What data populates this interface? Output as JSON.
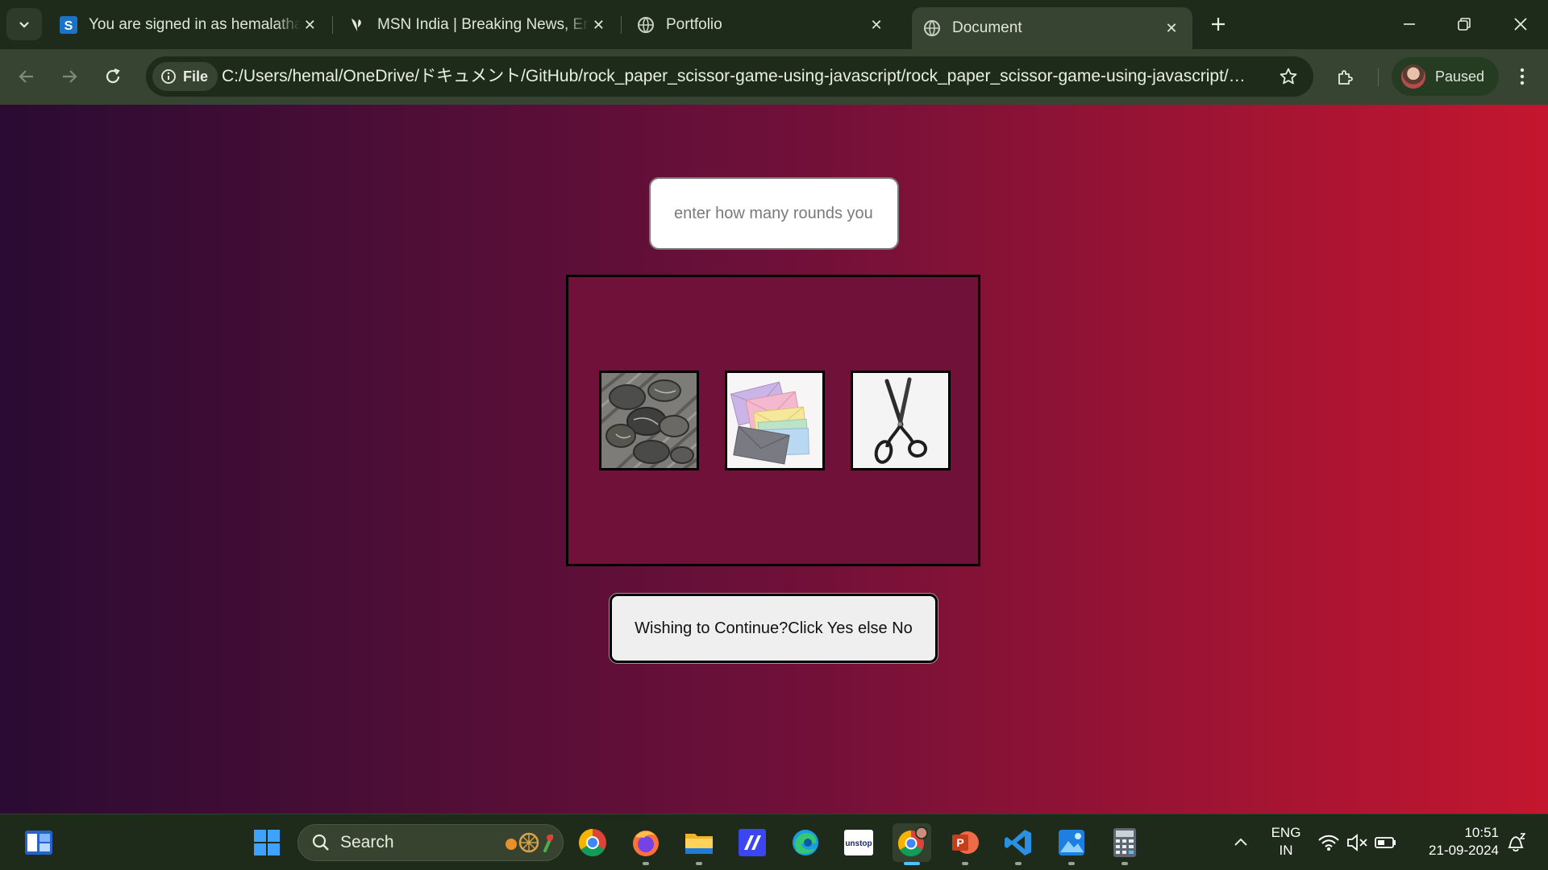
{
  "browser": {
    "tabs": [
      {
        "title": "You are signed in as hemalathaj",
        "favicon": "s-logo-icon",
        "active": false
      },
      {
        "title": "MSN India | Breaking News, Ent",
        "favicon": "msn-butterfly-icon",
        "active": false
      },
      {
        "title": "Portfolio",
        "favicon": "globe-icon",
        "active": false
      },
      {
        "title": "Document",
        "favicon": "globe-icon",
        "active": true
      }
    ],
    "address": {
      "chip_label": "File",
      "url": "C:/Users/hemal/OneDrive/ドキュメント/GitHub/rock_paper_scissor-game-using-javascript/rock_paper_scissor-game-using-javascript/practic..."
    },
    "profile": {
      "status": "Paused"
    }
  },
  "page": {
    "rounds_input": {
      "placeholder": "enter how many rounds you want to play",
      "value": ""
    },
    "choices": [
      {
        "name": "rock",
        "image": "rock-pebbles-image"
      },
      {
        "name": "paper",
        "image": "paper-envelopes-image"
      },
      {
        "name": "scissor",
        "image": "scissors-image"
      }
    ],
    "continue_button": "Wishing to Continue?Click Yes else No"
  },
  "taskbar": {
    "search_label": "Search",
    "apps": [
      "start-icon",
      "chrome-icon",
      "firefox-icon",
      "file-explorer-icon",
      "app-icon",
      "edge-icon",
      "unstop-icon",
      "chrome-profile-icon",
      "powerpoint-icon",
      "vscode-icon",
      "photos-icon",
      "calculator-icon"
    ],
    "tray": {
      "language_line1": "ENG",
      "language_line2": "IN",
      "time": "10:51",
      "date": "21-09-2024"
    }
  },
  "colors": {
    "gradient_start": "#2a0b33",
    "gradient_mid": "#6e1039",
    "gradient_end": "#c4162f",
    "chrome_frame": "#1f2b1a",
    "chrome_toolbar": "#374432"
  }
}
